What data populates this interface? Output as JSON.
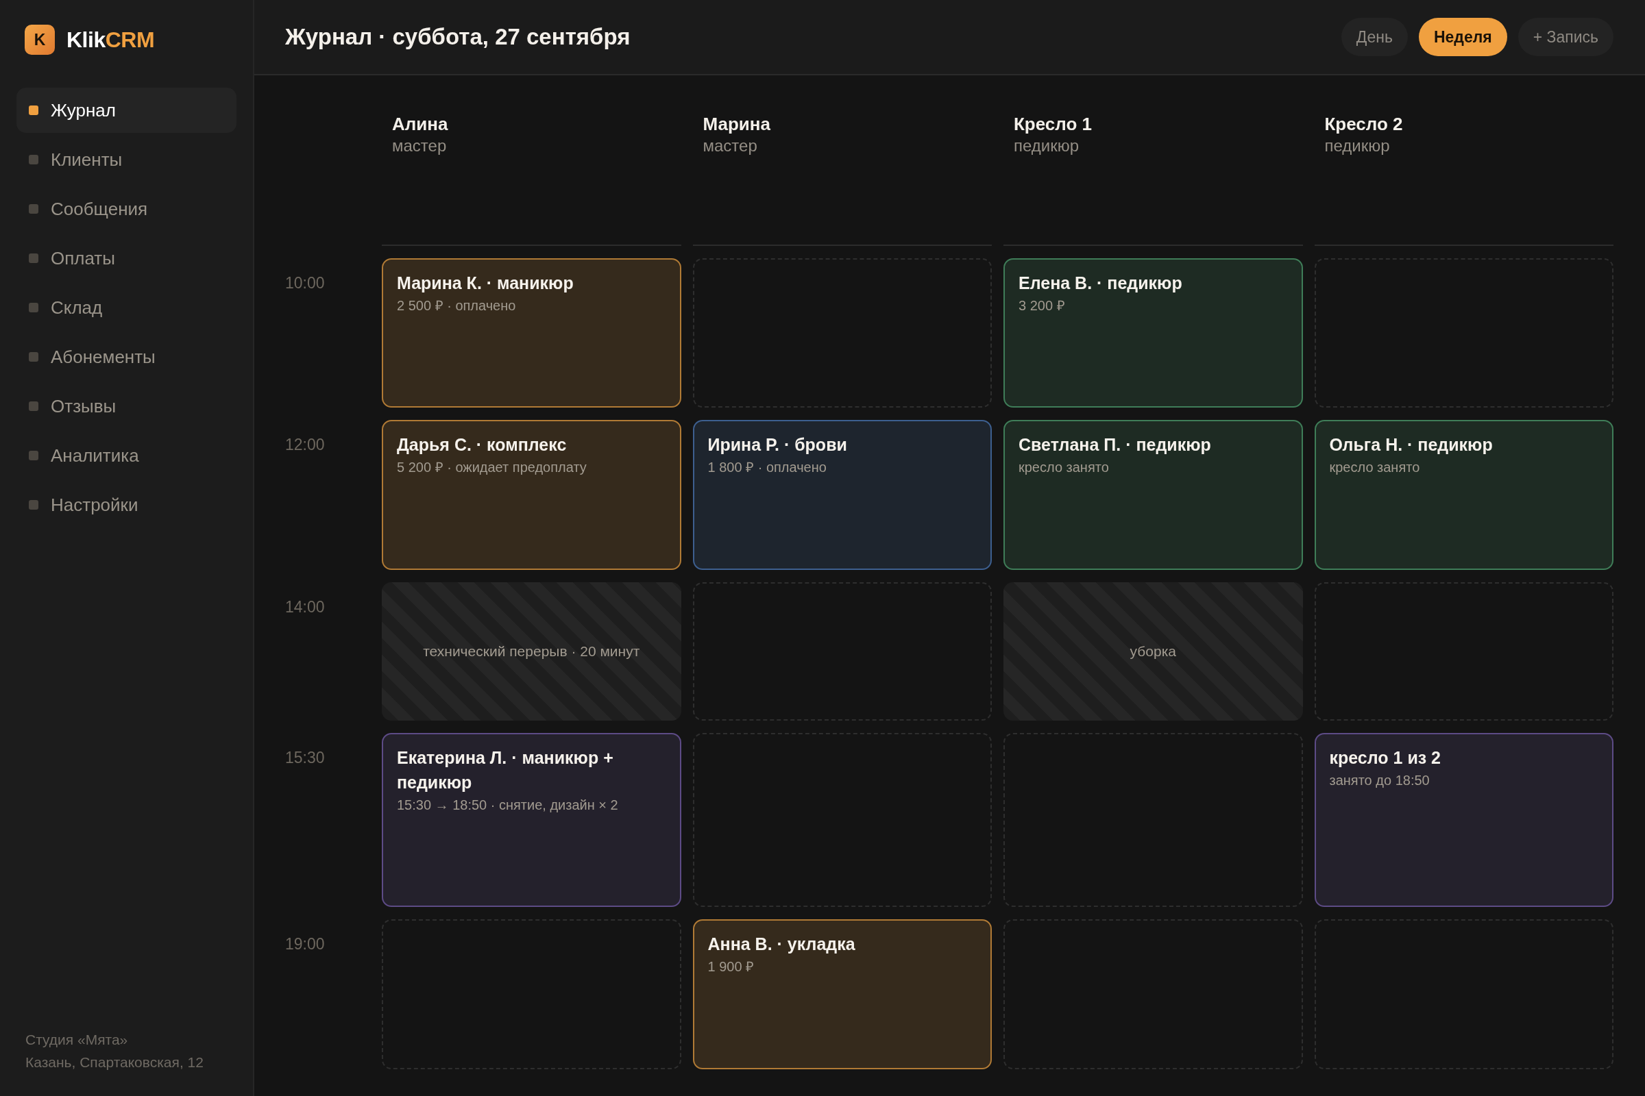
{
  "brand": {
    "badge": "K",
    "name": "Klik",
    "accent": "CRM"
  },
  "nav": [
    {
      "label": "Журнал",
      "selected": true
    },
    {
      "label": "Клиенты",
      "selected": false
    },
    {
      "label": "Сообщения",
      "selected": false
    },
    {
      "label": "Оплаты",
      "selected": false
    },
    {
      "label": "Склад",
      "selected": false
    },
    {
      "label": "Абонементы",
      "selected": false
    },
    {
      "label": "Отзывы",
      "selected": false
    },
    {
      "label": "Аналитика",
      "selected": false
    },
    {
      "label": "Настройки",
      "selected": false
    }
  ],
  "studio": {
    "name": "Студия «Мята»",
    "address": "Казань, Спартаковская, 12"
  },
  "header": {
    "title": "Журнал · суббота, 27 сентября",
    "view_tabs": [
      {
        "label": "День",
        "selected": false
      },
      {
        "label": "Неделя",
        "selected": true
      }
    ],
    "add_button": "+ Запись"
  },
  "columns": [
    {
      "name": "Алина",
      "role": "мастер"
    },
    {
      "name": "Марина",
      "role": "мастер"
    },
    {
      "name": "Кресло 1",
      "role": "педикюр"
    },
    {
      "name": "Кресло 2",
      "role": "педикюр"
    }
  ],
  "time_slots": [
    {
      "time": "10:00",
      "cells": [
        {
          "kind": "booking",
          "title": "Марина К. · маникюр",
          "detail": "2 500 ₽ · оплачено",
          "color": "#b07a35"
        },
        {
          "kind": "empty"
        },
        {
          "kind": "booking",
          "title": "Елена В. · педикюр",
          "detail": "3 200 ₽",
          "color": "#3f7d58"
        },
        {
          "kind": "empty"
        }
      ]
    },
    {
      "time": "12:00",
      "cells": [
        {
          "kind": "booking",
          "title": "Дарья С. · комплекс",
          "detail": "5 200 ₽ · ожидает предоплату",
          "color": "#b07a35"
        },
        {
          "kind": "booking",
          "title": "Ирина Р. · брови",
          "detail": "1 800 ₽ · оплачено",
          "color": "#3d5f8f"
        },
        {
          "kind": "booking",
          "title": "Светлана П. · педикюр",
          "detail": "кресло занято",
          "color": "#3f7d58"
        },
        {
          "kind": "booking",
          "title": "Ольга Н. · педикюр",
          "detail": "кресло занято",
          "color": "#3f7d58"
        }
      ]
    },
    {
      "time": "14:00",
      "cells": [
        {
          "kind": "break",
          "label": "технический перерыв · 20 минут"
        },
        {
          "kind": "empty"
        },
        {
          "kind": "break",
          "label": "уборка"
        },
        {
          "kind": "empty"
        }
      ]
    },
    {
      "time": "15:30",
      "cells": [
        {
          "kind": "booking",
          "title": "Екатерина Л. · маникюр + педикюр",
          "detail": "15:30 → 18:50 · снятие, дизайн × 2",
          "color": "#5d4b86"
        },
        {
          "kind": "empty"
        },
        {
          "kind": "empty"
        },
        {
          "kind": "booking",
          "title": "кресло 1 из 2",
          "detail": "занято до 18:50",
          "color": "#5d4b86"
        }
      ]
    },
    {
      "time": "19:00",
      "cells": [
        {
          "kind": "empty"
        },
        {
          "kind": "booking",
          "title": "Анна В. · укладка",
          "detail": "1 900 ₽",
          "color": "#b07a35"
        },
        {
          "kind": "empty"
        },
        {
          "kind": "empty"
        }
      ]
    }
  ]
}
